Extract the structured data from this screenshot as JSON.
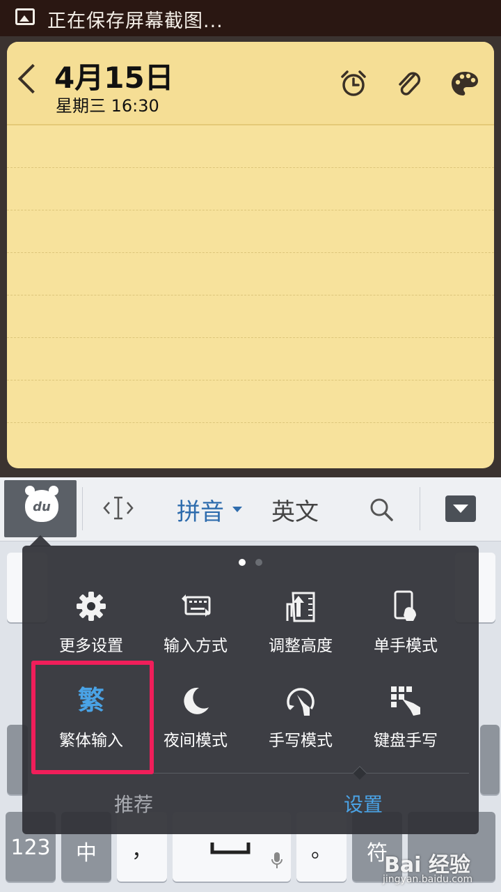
{
  "status_bar": {
    "text": "正在保存屏幕截图..."
  },
  "note": {
    "date": "4月15日",
    "subtitle": "星期三 16:30"
  },
  "keyboard_toolbar": {
    "logo_text": "du",
    "pinyin_label": "拼音",
    "english_label": "英文"
  },
  "keys": {
    "num_label": "123",
    "chinese_label": "中",
    "comma_label": "，",
    "period_label": "。",
    "symbol_label": "符"
  },
  "panel": {
    "items": [
      {
        "label": "更多设置",
        "icon": "gear-icon"
      },
      {
        "label": "输入方式",
        "icon": "keyboard-icon"
      },
      {
        "label": "调整高度",
        "icon": "adjust-height-icon"
      },
      {
        "label": "单手模式",
        "icon": "one-hand-icon"
      },
      {
        "label": "繁体输入",
        "icon": "traditional-icon",
        "glyph": "繁"
      },
      {
        "label": "夜间模式",
        "icon": "moon-icon"
      },
      {
        "label": "手写模式",
        "icon": "handwrite-icon"
      },
      {
        "label": "键盘手写",
        "icon": "keyboard-handwrite-icon"
      }
    ],
    "tabs": [
      {
        "label": "推荐",
        "active": false
      },
      {
        "label": "设置",
        "active": true
      }
    ],
    "page_dots": {
      "count": 2,
      "active_index": 0
    }
  },
  "colors": {
    "accent_blue": "#4aa3e6",
    "highlight_pink": "#f01e5a",
    "note_yellow": "#f7e29c"
  },
  "watermark": {
    "main": "Bai 经验",
    "sub": "jingyan.baidu.com"
  }
}
